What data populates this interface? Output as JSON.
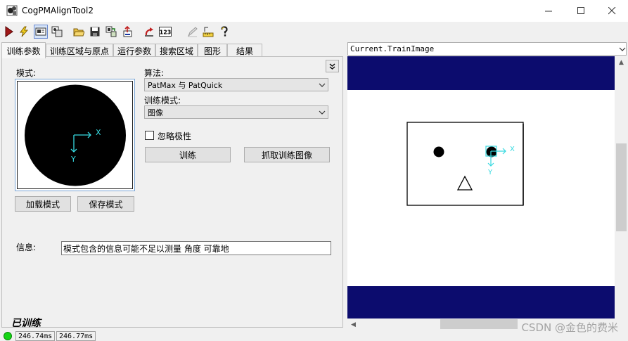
{
  "window": {
    "title": "CogPMAlignTool2",
    "icon": "cog-tool-icon",
    "controls": [
      "minimize-icon",
      "maximize-icon",
      "close-icon"
    ]
  },
  "toolbar": {
    "buttons": [
      "run-icon",
      "electric-icon",
      "show-dialog-icon",
      "local-graphics-icon",
      "open-icon",
      "save-icon",
      "import-icon",
      "export-icon",
      "reset-icon",
      "numeric-icon",
      "edit-icon",
      "ruler-icon",
      "help-icon"
    ],
    "numeric_label": "123"
  },
  "tabs": [
    "训练参数",
    "训练区域与原点",
    "运行参数",
    "搜索区域",
    "图形",
    "结果"
  ],
  "train_params": {
    "pattern_label": "模式:",
    "pattern_x_axis": "X",
    "pattern_y_axis": "Y",
    "algorithm_label": "算法:",
    "algorithm_value": "PatMax 与 PatQuick",
    "train_mode_label": "训练模式:",
    "train_mode_value": "图像",
    "ignore_polarity_label": "忽略极性",
    "ignore_polarity_checked": false,
    "train_button": "训练",
    "grab_train_image_button": "抓取训练图像",
    "load_pattern_button": "加载模式",
    "save_pattern_button": "保存模式",
    "info_label": "信息:",
    "info_value": "模式包含的信息可能不足以测量 角度 可靠地",
    "trained_status": "已训练"
  },
  "display": {
    "image_selector": "Current.TrainImage",
    "x_axis": "X",
    "y_axis": "Y"
  },
  "status": {
    "time1": "246.74ms",
    "time2": "246.77ms",
    "led_color": "#14d414"
  },
  "watermark": "CSDN @金色的费米"
}
